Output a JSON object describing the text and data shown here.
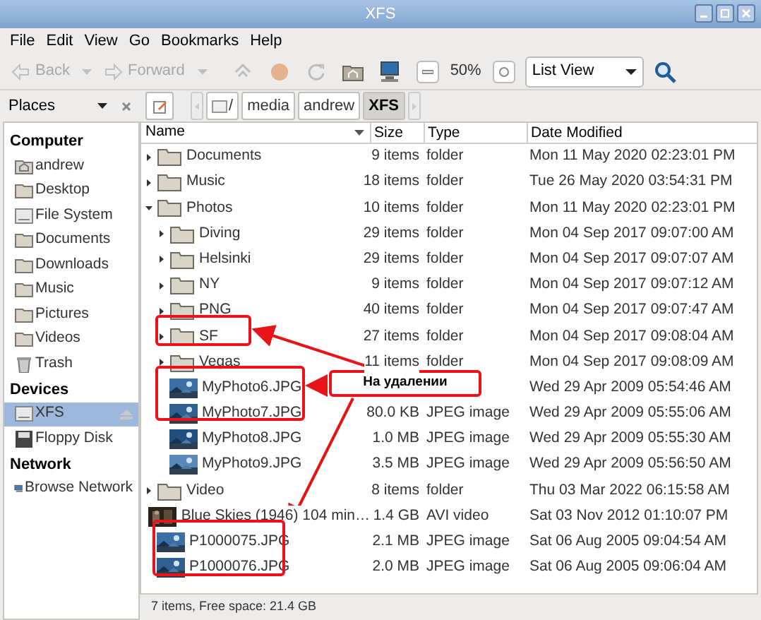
{
  "window": {
    "title": "XFS"
  },
  "menu": [
    "File",
    "Edit",
    "View",
    "Go",
    "Bookmarks",
    "Help"
  ],
  "toolbar": {
    "back": {
      "label": "Back",
      "disabled": true
    },
    "forward": {
      "label": "Forward",
      "disabled": true
    },
    "zoom": "50%",
    "view": "List View"
  },
  "places": {
    "label": "Places"
  },
  "path": [
    {
      "label": "/",
      "selected": false
    },
    {
      "label": "media",
      "selected": false
    },
    {
      "label": "andrew",
      "selected": false
    },
    {
      "label": "XFS",
      "selected": true
    }
  ],
  "sidebar": [
    {
      "heading": "Computer",
      "items": [
        {
          "label": "andrew",
          "kind": "home",
          "selected": false
        },
        {
          "label": "Desktop",
          "kind": "folder",
          "selected": false
        },
        {
          "label": "File System",
          "kind": "drive",
          "selected": false
        },
        {
          "label": "Documents",
          "kind": "folder",
          "selected": false
        },
        {
          "label": "Downloads",
          "kind": "folder",
          "selected": false
        },
        {
          "label": "Music",
          "kind": "folder",
          "selected": false
        },
        {
          "label": "Pictures",
          "kind": "folder",
          "selected": false
        },
        {
          "label": "Videos",
          "kind": "folder",
          "selected": false
        },
        {
          "label": "Trash",
          "kind": "trash",
          "selected": false
        }
      ]
    },
    {
      "heading": "Devices",
      "items": [
        {
          "label": "XFS",
          "kind": "drive",
          "selected": true,
          "eject": true
        },
        {
          "label": "Floppy Disk",
          "kind": "floppy",
          "selected": false
        }
      ]
    },
    {
      "heading": "Network",
      "items": [
        {
          "label": "Browse Network",
          "kind": "network",
          "selected": false
        }
      ]
    }
  ],
  "columns": [
    "Name",
    "Size",
    "Type",
    "Date Modified"
  ],
  "files": [
    {
      "name": "Documents",
      "kind": "folder",
      "expanded": false,
      "size": "9 items",
      "type": "folder",
      "date": "Mon 11 May 2020 02:23:01 PM"
    },
    {
      "name": "Music",
      "kind": "folder",
      "expanded": false,
      "size": "18 items",
      "type": "folder",
      "date": "Tue 26 May 2020 03:54:31 PM"
    },
    {
      "name": "Photos",
      "kind": "folder",
      "expanded": true,
      "size": "10 items",
      "type": "folder",
      "date": "Mon 11 May 2020 02:23:01 PM",
      "children": [
        {
          "name": "Diving",
          "kind": "folder",
          "expanded": false,
          "size": "29 items",
          "type": "folder",
          "date": "Mon 04 Sep 2017 09:07:00 AM"
        },
        {
          "name": "Helsinki",
          "kind": "folder",
          "expanded": false,
          "size": "29 items",
          "type": "folder",
          "date": "Mon 04 Sep 2017 09:07:07 AM"
        },
        {
          "name": "NY",
          "kind": "folder",
          "expanded": false,
          "size": "9 items",
          "type": "folder",
          "date": "Mon 04 Sep 2017 09:07:12 AM"
        },
        {
          "name": "PNG",
          "kind": "folder",
          "expanded": false,
          "size": "40 items",
          "type": "folder",
          "date": "Mon 04 Sep 2017 09:07:47 AM"
        },
        {
          "name": "SF",
          "kind": "folder",
          "expanded": false,
          "size": "27 items",
          "type": "folder",
          "date": "Mon 04 Sep 2017 09:08:04 AM"
        },
        {
          "name": "Vegas",
          "kind": "folder",
          "expanded": false,
          "size": "11 items",
          "type": "folder",
          "date": "Mon 04 Sep 2017 09:08:09 AM"
        },
        {
          "name": "MyPhoto6.JPG",
          "date": "Wed 29 Apr 2009 05:54:46 AM"
        },
        {
          "name": "MyPhoto7.JPG",
          "size": "80.0 KB",
          "type": "JPEG image",
          "date": "Wed 29 Apr 2009 05:55:06 AM"
        },
        {
          "name": "MyPhoto8.JPG",
          "size": "1.0 MB",
          "type": "JPEG image",
          "date": "Wed 29 Apr 2009 05:55:30 AM"
        },
        {
          "name": "MyPhoto9.JPG",
          "size": "3.5 MB",
          "type": "JPEG image",
          "date": "Wed 29 Apr 2009 05:56:50 AM"
        }
      ]
    },
    {
      "name": "Video",
      "kind": "folder",
      "expanded": false,
      "size": "8 items",
      "type": "folder",
      "date": "Thu 03 Mar 2022 06:15:58 AM"
    },
    {
      "name": "Blue Skies (1946) 104 min…",
      "kind": "video",
      "size": "1.4 GB",
      "type": "AVI video",
      "date": "Sat 03 Nov 2012 01:10:07 PM"
    },
    {
      "name": "P1000075.JPG",
      "size": "2.1 MB",
      "type": "JPEG image",
      "date": "Sat 06 Aug 2005 09:04:54 AM"
    },
    {
      "name": "P1000076.JPG",
      "size": "2.0 MB",
      "type": "JPEG image",
      "date": "Sat 06 Aug 2005 09:06:04 AM"
    }
  ],
  "annotation": {
    "label": "На удалении"
  },
  "status_bar": "7 items, Free space: 21.4 GB"
}
